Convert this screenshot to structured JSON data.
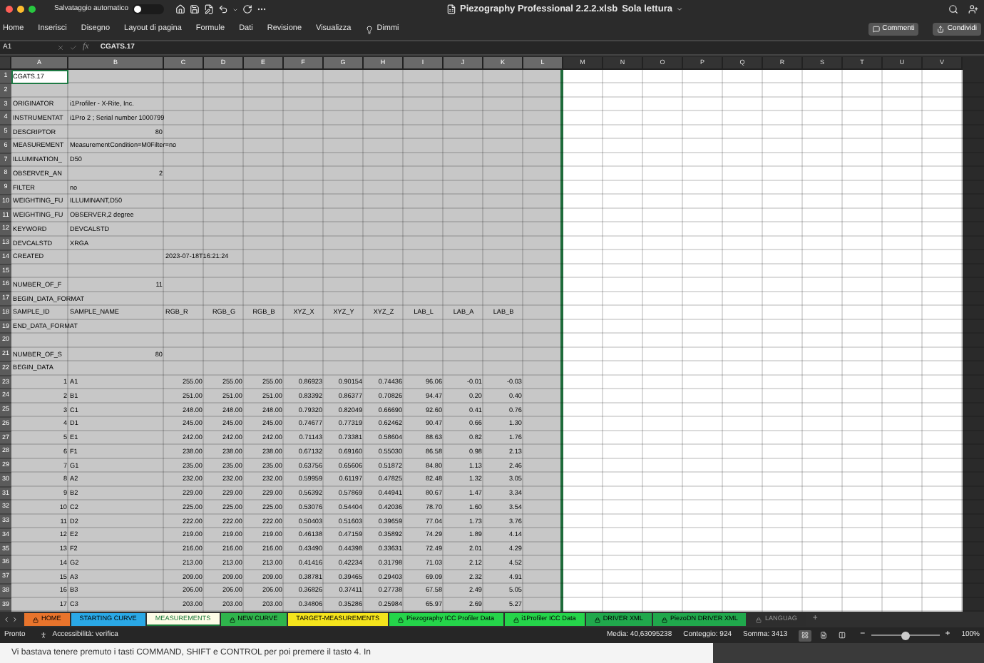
{
  "window": {
    "autosave_label": "Salvataggio automatico",
    "autosave_on": false,
    "title": "Piezography Professional 2.2.2.xlsb",
    "mode": "Sola lettura"
  },
  "menu": [
    "Home",
    "Inserisci",
    "Disegno",
    "Layout di pagina",
    "Formule",
    "Dati",
    "Revisione",
    "Visualizza"
  ],
  "tell_me": "Dimmi",
  "actions": [
    "Commenti",
    "Condividi"
  ],
  "formula_bar": {
    "name_box": "A1",
    "function_label": "fx",
    "formula": "CGATS.17"
  },
  "sheet": {
    "columns": [
      {
        "label": "A",
        "selected": true
      },
      {
        "label": "B",
        "selected": true
      },
      {
        "label": "C",
        "selected": true
      },
      {
        "label": "D",
        "selected": true
      },
      {
        "label": "E",
        "selected": true
      },
      {
        "label": "F",
        "selected": true
      },
      {
        "label": "G",
        "selected": true
      },
      {
        "label": "H",
        "selected": true
      },
      {
        "label": "I",
        "selected": true
      },
      {
        "label": "J",
        "selected": true
      },
      {
        "label": "K",
        "selected": true
      },
      {
        "label": "L",
        "selected": true
      },
      {
        "label": "M",
        "selected": false
      },
      {
        "label": "N",
        "selected": false
      },
      {
        "label": "O",
        "selected": false
      },
      {
        "label": "P",
        "selected": false
      },
      {
        "label": "Q",
        "selected": false
      },
      {
        "label": "R",
        "selected": false
      },
      {
        "label": "S",
        "selected": false
      },
      {
        "label": "T",
        "selected": false
      },
      {
        "label": "U",
        "selected": false
      },
      {
        "label": "V",
        "selected": false
      }
    ],
    "rows": [
      {
        "label": "1",
        "kind": "text",
        "cells": {
          "A": {
            "text": "CGATS.17",
            "active": true
          }
        }
      },
      {
        "label": "2"
      },
      {
        "label": "3",
        "kind": "text",
        "cells": {
          "A": "ORIGINATOR",
          "B": "i1Profiler - X-Rite, Inc."
        }
      },
      {
        "label": "4",
        "kind": "text",
        "cells": {
          "A": "INSTRUMENTAT",
          "B": "i1Pro 2 ; Serial number 1000799"
        }
      },
      {
        "label": "5",
        "kind": "count",
        "cells": {
          "A": "DESCRIPTOR",
          "B": "80"
        }
      },
      {
        "label": "6",
        "kind": "text",
        "cells": {
          "A": "MEASUREMENT",
          "B": "MeasurementCondition=M0Filter=no"
        }
      },
      {
        "label": "7",
        "kind": "text",
        "cells": {
          "A": "ILLUMINATION_",
          "B": "D50"
        }
      },
      {
        "label": "8",
        "kind": "count",
        "cells": {
          "A": "OBSERVER_AN",
          "B": "2"
        }
      },
      {
        "label": "9",
        "kind": "text",
        "cells": {
          "A": "FILTER",
          "B": "no"
        }
      },
      {
        "label": "10",
        "kind": "text",
        "cells": {
          "A": "WEIGHTING_FU",
          "B": "ILLUMINANT,D50"
        }
      },
      {
        "label": "11",
        "kind": "text",
        "cells": {
          "A": "WEIGHTING_FU",
          "B": "OBSERVER,2 degree"
        }
      },
      {
        "label": "12",
        "kind": "text",
        "cells": {
          "A": "KEYWORD",
          "B": "DEVCALSTD"
        }
      },
      {
        "label": "13",
        "kind": "text",
        "cells": {
          "A": "DEVCALSTD",
          "B": "XRGA"
        }
      },
      {
        "label": "14",
        "kind": "text",
        "cells": {
          "A": "CREATED",
          "C": "2023-07-18T16:21:24"
        }
      },
      {
        "label": "15"
      },
      {
        "label": "16",
        "kind": "count",
        "cells": {
          "A": "NUMBER_OF_F",
          "B": "11"
        }
      },
      {
        "label": "17",
        "kind": "text",
        "cells": {
          "A": "BEGIN_DATA_FORMAT"
        }
      },
      {
        "label": "18",
        "kind": "header",
        "cells": {
          "A": "SAMPLE_ID",
          "B": "SAMPLE_NAME",
          "C": "RGB_R",
          "D": "RGB_G",
          "E": "RGB_B",
          "F": "XYZ_X",
          "G": "XYZ_Y",
          "H": "XYZ_Z",
          "I": "LAB_L",
          "J": "LAB_A",
          "K": "LAB_B"
        }
      },
      {
        "label": "19",
        "kind": "text",
        "cells": {
          "A": "END_DATA_FORMAT"
        }
      },
      {
        "label": "20"
      },
      {
        "label": "21",
        "kind": "count",
        "cells": {
          "A": "NUMBER_OF_S",
          "B": "80"
        }
      },
      {
        "label": "22",
        "kind": "text",
        "cells": {
          "A": "BEGIN_DATA"
        }
      },
      {
        "label": "23",
        "kind": "data",
        "cells": {
          "A": "1",
          "B": "A1",
          "C": "255.00",
          "D": "255.00",
          "E": "255.00",
          "F": "0.86923",
          "G": "0.90154",
          "H": "0.74436",
          "I": "96.06",
          "J": "-0.01",
          "K": "-0.03"
        }
      },
      {
        "label": "24",
        "kind": "data",
        "cells": {
          "A": "2",
          "B": "B1",
          "C": "251.00",
          "D": "251.00",
          "E": "251.00",
          "F": "0.83392",
          "G": "0.86377",
          "H": "0.70826",
          "I": "94.47",
          "J": "0.20",
          "K": "0.40"
        }
      },
      {
        "label": "25",
        "kind": "data",
        "cells": {
          "A": "3",
          "B": "C1",
          "C": "248.00",
          "D": "248.00",
          "E": "248.00",
          "F": "0.79320",
          "G": "0.82049",
          "H": "0.66690",
          "I": "92.60",
          "J": "0.41",
          "K": "0.76"
        }
      },
      {
        "label": "26",
        "kind": "data",
        "cells": {
          "A": "4",
          "B": "D1",
          "C": "245.00",
          "D": "245.00",
          "E": "245.00",
          "F": "0.74677",
          "G": "0.77319",
          "H": "0.62462",
          "I": "90.47",
          "J": "0.66",
          "K": "1.30"
        }
      },
      {
        "label": "27",
        "kind": "data",
        "cells": {
          "A": "5",
          "B": "E1",
          "C": "242.00",
          "D": "242.00",
          "E": "242.00",
          "F": "0.71143",
          "G": "0.73381",
          "H": "0.58604",
          "I": "88.63",
          "J": "0.82",
          "K": "1.76"
        }
      },
      {
        "label": "28",
        "kind": "data",
        "cells": {
          "A": "6",
          "B": "F1",
          "C": "238.00",
          "D": "238.00",
          "E": "238.00",
          "F": "0.67132",
          "G": "0.69160",
          "H": "0.55030",
          "I": "86.58",
          "J": "0.98",
          "K": "2.13"
        }
      },
      {
        "label": "29",
        "kind": "data",
        "cells": {
          "A": "7",
          "B": "G1",
          "C": "235.00",
          "D": "235.00",
          "E": "235.00",
          "F": "0.63756",
          "G": "0.65606",
          "H": "0.51872",
          "I": "84.80",
          "J": "1.13",
          "K": "2.46"
        }
      },
      {
        "label": "30",
        "kind": "data",
        "cells": {
          "A": "8",
          "B": "A2",
          "C": "232.00",
          "D": "232.00",
          "E": "232.00",
          "F": "0.59959",
          "G": "0.61197",
          "H": "0.47825",
          "I": "82.48",
          "J": "1.32",
          "K": "3.05"
        }
      },
      {
        "label": "31",
        "kind": "data",
        "cells": {
          "A": "9",
          "B": "B2",
          "C": "229.00",
          "D": "229.00",
          "E": "229.00",
          "F": "0.56392",
          "G": "0.57869",
          "H": "0.44941",
          "I": "80.67",
          "J": "1.47",
          "K": "3.34"
        }
      },
      {
        "label": "32",
        "kind": "data",
        "cells": {
          "A": "10",
          "B": "C2",
          "C": "225.00",
          "D": "225.00",
          "E": "225.00",
          "F": "0.53076",
          "G": "0.54404",
          "H": "0.42036",
          "I": "78.70",
          "J": "1.60",
          "K": "3.54"
        }
      },
      {
        "label": "33",
        "kind": "data",
        "cells": {
          "A": "11",
          "B": "D2",
          "C": "222.00",
          "D": "222.00",
          "E": "222.00",
          "F": "0.50403",
          "G": "0.51603",
          "H": "0.39659",
          "I": "77.04",
          "J": "1.73",
          "K": "3.76"
        }
      },
      {
        "label": "34",
        "kind": "data",
        "cells": {
          "A": "12",
          "B": "E2",
          "C": "219.00",
          "D": "219.00",
          "E": "219.00",
          "F": "0.46138",
          "G": "0.47159",
          "H": "0.35892",
          "I": "74.29",
          "J": "1.89",
          "K": "4.14"
        }
      },
      {
        "label": "35",
        "kind": "data",
        "cells": {
          "A": "13",
          "B": "F2",
          "C": "216.00",
          "D": "216.00",
          "E": "216.00",
          "F": "0.43490",
          "G": "0.44398",
          "H": "0.33631",
          "I": "72.49",
          "J": "2.01",
          "K": "4.29"
        }
      },
      {
        "label": "36",
        "kind": "data",
        "cells": {
          "A": "14",
          "B": "G2",
          "C": "213.00",
          "D": "213.00",
          "E": "213.00",
          "F": "0.41416",
          "G": "0.42234",
          "H": "0.31798",
          "I": "71.03",
          "J": "2.12",
          "K": "4.52"
        }
      },
      {
        "label": "37",
        "kind": "data",
        "cells": {
          "A": "15",
          "B": "A3",
          "C": "209.00",
          "D": "209.00",
          "E": "209.00",
          "F": "0.38781",
          "G": "0.39465",
          "H": "0.29403",
          "I": "69.09",
          "J": "2.32",
          "K": "4.91"
        }
      },
      {
        "label": "38",
        "kind": "data",
        "cells": {
          "A": "16",
          "B": "B3",
          "C": "206.00",
          "D": "206.00",
          "E": "206.00",
          "F": "0.36826",
          "G": "0.37411",
          "H": "0.27738",
          "I": "67.58",
          "J": "2.49",
          "K": "5.05"
        }
      },
      {
        "label": "39",
        "kind": "data",
        "cells": {
          "A": "17",
          "B": "C3",
          "C": "203.00",
          "D": "203.00",
          "E": "203.00",
          "F": "0.34806",
          "G": "0.35286",
          "H": "0.25984",
          "I": "65.97",
          "J": "2.69",
          "K": "5.27"
        }
      }
    ]
  },
  "sheet_tabs": [
    {
      "label": "HOME",
      "color": "#e8742c",
      "locked": true,
      "selected": false
    },
    {
      "label": "STARTING CURVE",
      "color": "#2aa8e6",
      "locked": false,
      "selected": false
    },
    {
      "label": "MEASUREMENTS",
      "color": "#fdfbe6",
      "locked": false,
      "selected": true
    },
    {
      "label": "NEW CURVE",
      "color": "#2fb44c",
      "locked": true,
      "selected": false
    },
    {
      "label": "TARGET-MEASUREMENTS",
      "color": "#f4e41c",
      "locked": false,
      "selected": false
    },
    {
      "label": "Piezography ICC Profiler Data",
      "color": "#25d44a",
      "locked": true,
      "selected": false
    },
    {
      "label": "i1Profiler ICC Data",
      "color": "#25d44a",
      "locked": true,
      "selected": false
    },
    {
      "label": "DRIVER XML",
      "color": "#20a84c",
      "locked": true,
      "selected": false
    },
    {
      "label": "PiezoDN DRIVER XML",
      "color": "#20a84c",
      "locked": true,
      "selected": false
    },
    {
      "label": "LANGUAG",
      "color": "#2e2e2e",
      "locked": true,
      "selected": false
    }
  ],
  "add_sheet": "+",
  "status_bar": {
    "ready": "Pronto",
    "accessibility": "Accessibilità: verifica",
    "stats": [
      "Media: 40,63095238",
      "Conteggio: 924",
      "Somma: 3413"
    ],
    "views": [
      {
        "selected": true
      },
      {
        "selected": false
      },
      {
        "selected": false
      }
    ],
    "zoom": {
      "minus": "−",
      "level": 0.5,
      "plus": "+",
      "reading": "100%"
    }
  },
  "below_window": {
    "text": "Vi bastava tenere premuto i tasti COMMAND, SHIFT e CONTROL per poi premere il tasto 4. In"
  }
}
